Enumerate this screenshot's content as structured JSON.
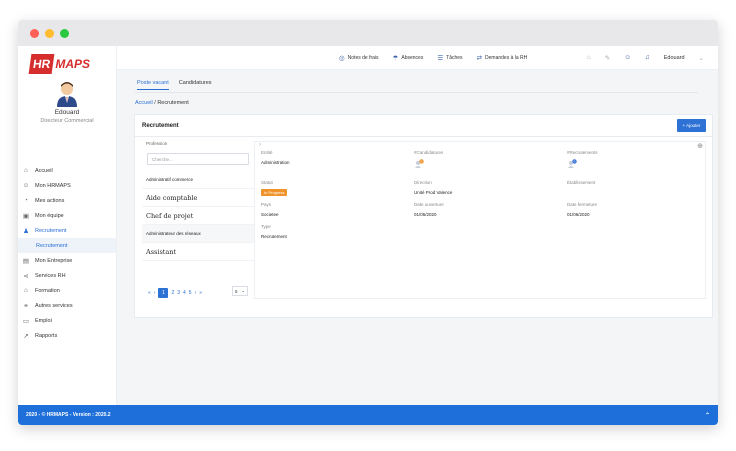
{
  "colors": {
    "accent": "#2f72d6",
    "brand_red": "#d62d2d",
    "status_orange": "#f0932b",
    "footer": "#1e6fd9"
  },
  "window_dots": [
    "#ff5f57",
    "#febc2e",
    "#28c840"
  ],
  "logo": {
    "badge": "HR",
    "text": "MAPS"
  },
  "user": {
    "name": "Edouard",
    "role": "Directeur Commercial"
  },
  "sidebar": {
    "items": [
      {
        "label": "Accueil",
        "icon": "home-icon",
        "glyph": "⌂"
      },
      {
        "label": "Mon HRMAPS",
        "icon": "user-icon",
        "glyph": "☺"
      },
      {
        "label": "Mes actions",
        "icon": "gauge-icon",
        "glyph": "◔"
      },
      {
        "label": "Mon équipe",
        "icon": "team-icon",
        "glyph": "▣"
      },
      {
        "label": "Recrutement",
        "icon": "recruit-icon",
        "glyph": "♟",
        "active": true
      },
      {
        "label": "Mon Entreprise",
        "icon": "building-icon",
        "glyph": "▤"
      },
      {
        "label": "Services RH",
        "icon": "share-icon",
        "glyph": "⋖"
      },
      {
        "label": "Formation",
        "icon": "graduation-icon",
        "glyph": "⌂"
      },
      {
        "label": "Autres services",
        "icon": "handshake-icon",
        "glyph": "⚭"
      },
      {
        "label": "Emploi",
        "icon": "briefcase-icon",
        "glyph": "▭"
      },
      {
        "label": "Rapports",
        "icon": "chart-icon",
        "glyph": "↗"
      }
    ],
    "sub_item": "Recrutement"
  },
  "topbar": {
    "items": [
      {
        "label": "Notes de frais",
        "icon": "globe-icon",
        "glyph": "◎"
      },
      {
        "label": "Absences",
        "icon": "palm-icon",
        "glyph": "☂"
      },
      {
        "label": "Tâches",
        "icon": "list-icon",
        "glyph": "☰"
      },
      {
        "label": "Demandes à la RH",
        "icon": "exchange-icon",
        "glyph": "⇄"
      }
    ],
    "user": "Edouard",
    "chevron": "⌄"
  },
  "tabs": [
    "Poste vacant",
    "Candidatures"
  ],
  "breadcrumb": {
    "home": "Accueil",
    "sep": "/",
    "current": "Recrutement"
  },
  "card": {
    "title": "Recrutement",
    "add_label": "+ Ajouter",
    "left": {
      "label": "Profession",
      "search_placeholder": "Cherche...",
      "items": [
        {
          "text": "Administratif commerce",
          "style": "small"
        },
        {
          "text": "Aide comptable",
          "style": "big"
        },
        {
          "text": "Chef de projet",
          "style": "big"
        },
        {
          "text": "Administrateur des réseaux",
          "style": "small",
          "hl": true
        },
        {
          "text": "Assistant",
          "style": "big"
        }
      ],
      "pagination": {
        "prev_first": "«",
        "prev": "‹",
        "pages": [
          "1",
          "2",
          "3",
          "4",
          "5"
        ],
        "next": "›",
        "next_last": "»",
        "active": "1"
      },
      "page_size": "5",
      "page_size_chevron": "⌄"
    },
    "detail": {
      "top_arrow": "›",
      "plus": "⊕",
      "entite_label": "Entité",
      "entite_value": "Administration",
      "candidatures_label": "#Candidatures",
      "candidatures_count": "0",
      "recrutements_label": "#Recrutements",
      "recrutements_count": "0",
      "statut_label": "Statut",
      "statut_value": "In Progress",
      "direction_label": "Direction",
      "direction_value": "Unité Prod Valence",
      "etablissement_label": "Établissement",
      "pays_label": "Pays",
      "pays_value": "Societee",
      "date_ouverture_label": "Date ouverture",
      "date_ouverture_value": "01/05/2020",
      "date_fermeture_label": "Date fermeture",
      "date_fermeture_value": "01/06/2020",
      "type_label": "Type",
      "type_value": "Recrutement"
    }
  },
  "footer": {
    "text": "2020 - © HRMAPS - Version : 2020.2",
    "chevron": "⌃"
  }
}
